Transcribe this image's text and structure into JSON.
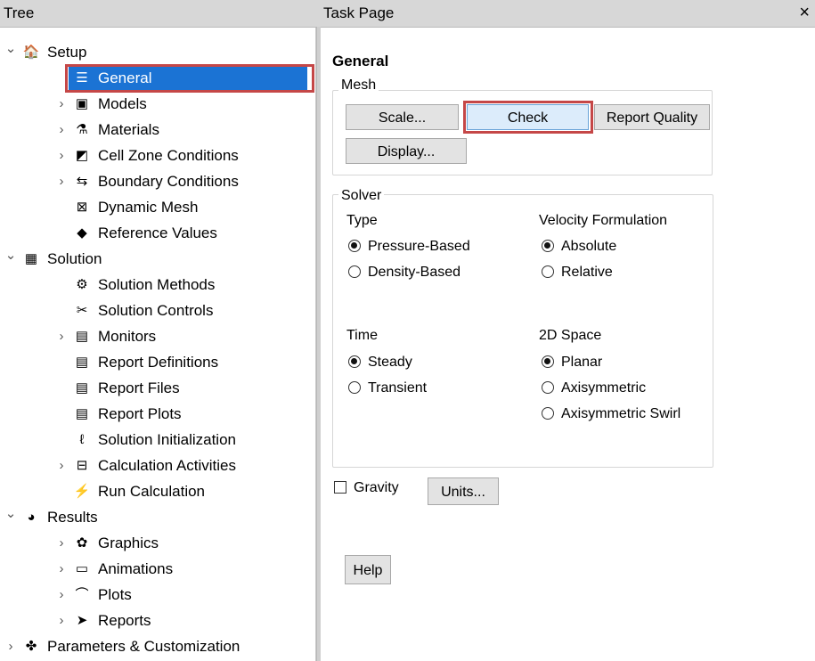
{
  "panels": {
    "tree_title": "Tree",
    "task_title": "Task Page",
    "close_glyph": "×"
  },
  "tree": {
    "items": [
      {
        "label": "Setup",
        "expander": "v",
        "icon": "setup-icon",
        "glyph": "🏠",
        "depth": 0
      },
      {
        "label": "General",
        "expander": "",
        "icon": "general-icon",
        "glyph": "☰",
        "depth": 1,
        "selected": true
      },
      {
        "label": "Models",
        "expander": ">",
        "icon": "models-icon",
        "glyph": "▣",
        "depth": 1
      },
      {
        "label": "Materials",
        "expander": ">",
        "icon": "materials-icon",
        "glyph": "⚗",
        "depth": 1
      },
      {
        "label": "Cell Zone Conditions",
        "expander": ">",
        "icon": "cell-zone-icon",
        "glyph": "◩",
        "depth": 1
      },
      {
        "label": "Boundary Conditions",
        "expander": ">",
        "icon": "boundary-icon",
        "glyph": "⇆",
        "depth": 1
      },
      {
        "label": "Dynamic Mesh",
        "expander": "",
        "icon": "dynamic-mesh-icon",
        "glyph": "⊠",
        "depth": 1
      },
      {
        "label": "Reference Values",
        "expander": "",
        "icon": "reference-values-icon",
        "glyph": "◆",
        "depth": 1
      },
      {
        "label": "Solution",
        "expander": "v",
        "icon": "solution-icon",
        "glyph": "▦",
        "depth": 0
      },
      {
        "label": "Solution Methods",
        "expander": "",
        "icon": "solution-methods-icon",
        "glyph": "⚙",
        "depth": 1
      },
      {
        "label": "Solution Controls",
        "expander": "",
        "icon": "solution-controls-icon",
        "glyph": "✂",
        "depth": 1
      },
      {
        "label": "Monitors",
        "expander": ">",
        "icon": "monitors-icon",
        "glyph": "▤",
        "depth": 1
      },
      {
        "label": "Report Definitions",
        "expander": "",
        "icon": "report-definitions-icon",
        "glyph": "▤",
        "depth": 1
      },
      {
        "label": "Report Files",
        "expander": "",
        "icon": "report-files-icon",
        "glyph": "▤",
        "depth": 1
      },
      {
        "label": "Report Plots",
        "expander": "",
        "icon": "report-plots-icon",
        "glyph": "▤",
        "depth": 1
      },
      {
        "label": "Solution Initialization",
        "expander": "",
        "icon": "initialization-icon",
        "glyph": "ℓ",
        "depth": 1
      },
      {
        "label": "Calculation Activities",
        "expander": ">",
        "icon": "calculation-activities-icon",
        "glyph": "⊟",
        "depth": 1
      },
      {
        "label": "Run Calculation",
        "expander": "",
        "icon": "run-calculation-icon",
        "glyph": "⚡",
        "depth": 1
      },
      {
        "label": "Results",
        "expander": "v",
        "icon": "results-icon",
        "glyph": "◕",
        "depth": 0
      },
      {
        "label": "Graphics",
        "expander": ">",
        "icon": "graphics-icon",
        "glyph": "✿",
        "depth": 1
      },
      {
        "label": "Animations",
        "expander": ">",
        "icon": "animations-icon",
        "glyph": "▭",
        "depth": 1
      },
      {
        "label": "Plots",
        "expander": ">",
        "icon": "plots-icon",
        "glyph": "⌒",
        "depth": 1
      },
      {
        "label": "Reports",
        "expander": ">",
        "icon": "reports-icon",
        "glyph": "➤",
        "depth": 1
      },
      {
        "label": "Parameters & Customization",
        "expander": ">",
        "icon": "parameters-icon",
        "glyph": "✤",
        "depth": 0
      }
    ]
  },
  "task": {
    "heading": "General",
    "mesh": {
      "group_label": "Mesh",
      "scale_label": "Scale...",
      "check_label": "Check",
      "report_quality_label": "Report Quality",
      "display_label": "Display..."
    },
    "solver": {
      "group_label": "Solver",
      "type_label": "Type",
      "type_options": [
        {
          "label": "Pressure-Based",
          "selected": true
        },
        {
          "label": "Density-Based",
          "selected": false
        }
      ],
      "velocity_label": "Velocity Formulation",
      "velocity_options": [
        {
          "label": "Absolute",
          "selected": true
        },
        {
          "label": "Relative",
          "selected": false
        }
      ],
      "time_label": "Time",
      "time_options": [
        {
          "label": "Steady",
          "selected": true
        },
        {
          "label": "Transient",
          "selected": false
        }
      ],
      "space_label": "2D Space",
      "space_options": [
        {
          "label": "Planar",
          "selected": true
        },
        {
          "label": "Axisymmetric",
          "selected": false
        },
        {
          "label": "Axisymmetric Swirl",
          "selected": false
        }
      ]
    },
    "gravity_label": "Gravity",
    "gravity_checked": false,
    "units_label": "Units...",
    "help_label": "Help"
  },
  "colors": {
    "selected_row": "#1b73d4",
    "highlight_box": "#c54747",
    "check_button": "#dcecfb"
  }
}
